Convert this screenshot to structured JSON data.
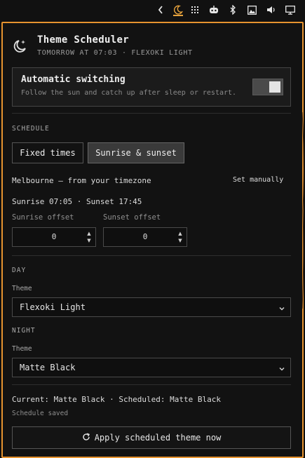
{
  "tray": {
    "icons": [
      "chevron-left-icon",
      "moon-icon",
      "grid-icon",
      "robot-icon",
      "bluetooth-icon",
      "image-icon",
      "volume-icon",
      "monitor-icon"
    ],
    "accent": "#e6a23c"
  },
  "header": {
    "title": "Theme Scheduler",
    "subtitle": "TOMORROW AT 07:03 · FLEXOKI LIGHT"
  },
  "auto": {
    "title": "Automatic switching",
    "description": "Follow the sun and catch up after sleep or restart.",
    "enabled": true
  },
  "schedule": {
    "label": "SCHEDULE",
    "modes": [
      "Fixed times",
      "Sunrise & sunset"
    ],
    "active_mode": "Sunrise & sunset",
    "location": "Melbourne — from your timezone",
    "set_manually": "Set manually",
    "sun_times": "Sunrise 07:05 · Sunset 17:45",
    "sunrise_offset_label": "Sunrise offset",
    "sunrise_offset": "0",
    "sunset_offset_label": "Sunset offset",
    "sunset_offset": "0"
  },
  "day": {
    "label": "DAY",
    "theme_label": "Theme",
    "theme": "Flexoki Light"
  },
  "night": {
    "label": "NIGHT",
    "theme_label": "Theme",
    "theme": "Matte Black"
  },
  "status": {
    "current": "Current: Matte Black · Scheduled: Matte Black",
    "saved": "Schedule saved"
  },
  "apply_button": "Apply scheduled theme now",
  "colors": {
    "panel_border": "#e6932f",
    "background": "#121212"
  }
}
